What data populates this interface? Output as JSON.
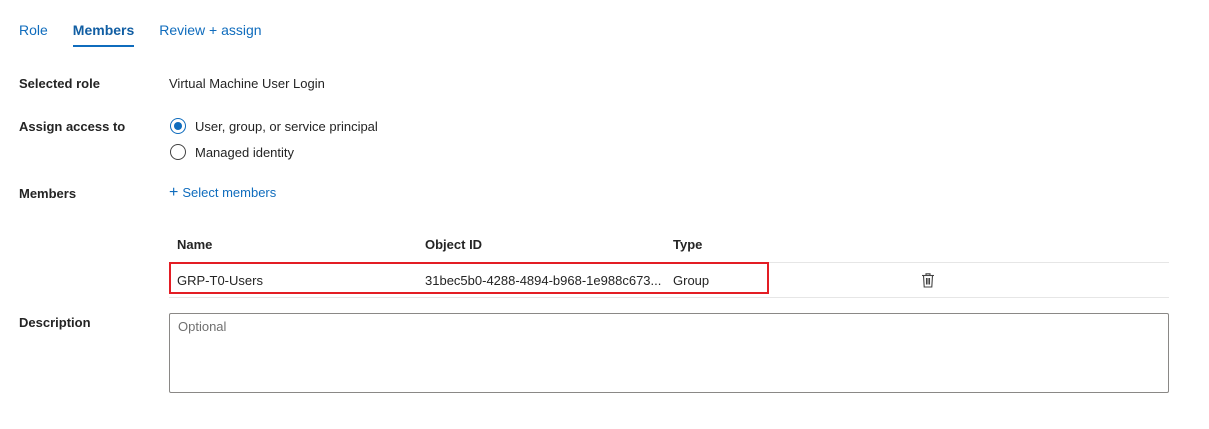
{
  "tabs": [
    {
      "label": "Role",
      "active": false
    },
    {
      "label": "Members",
      "active": true
    },
    {
      "label": "Review + assign",
      "active": false
    }
  ],
  "form": {
    "selected_role_label": "Selected role",
    "selected_role_value": "Virtual Machine User Login",
    "assign_access_label": "Assign access to",
    "assign_options": [
      {
        "label": "User, group, or service principal",
        "checked": true
      },
      {
        "label": "Managed identity",
        "checked": false
      }
    ],
    "members_label": "Members",
    "select_members_label": "Select members",
    "description_label": "Description",
    "description_placeholder": "Optional"
  },
  "members_table": {
    "columns": [
      "Name",
      "Object ID",
      "Type"
    ],
    "rows": [
      {
        "name": "GRP-T0-Users",
        "object_id": "31bec5b0-4288-4894-b968-1e988c673...",
        "type": "Group"
      }
    ]
  },
  "colors": {
    "accent": "#0f6cbd",
    "highlight": "#e31d24"
  },
  "icons": {
    "plus": "plus-icon",
    "delete": "trash-icon"
  }
}
